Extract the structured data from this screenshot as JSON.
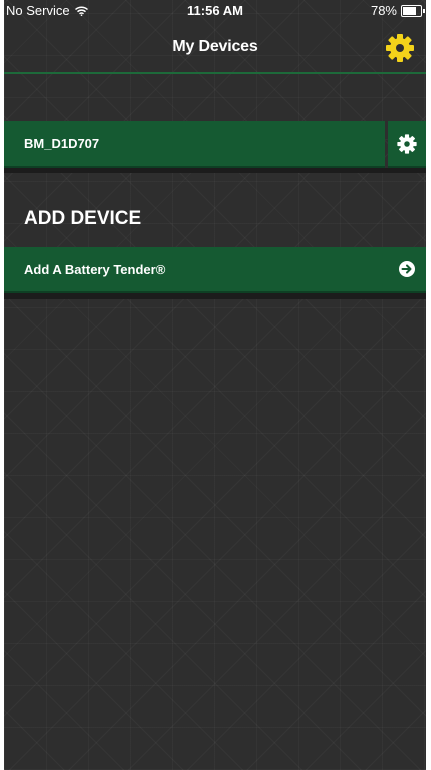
{
  "status_bar": {
    "carrier": "No Service",
    "time": "11:56 AM",
    "battery": "78%",
    "battery_level": 0.78
  },
  "nav": {
    "title": "My Devices",
    "settings_icon": "gear-icon",
    "settings_color": "#f3d31a"
  },
  "devices": [
    {
      "name": "BM_D1D707",
      "settings_icon": "gear-icon"
    }
  ],
  "add_section": {
    "title": "ADD DEVICE",
    "item_label": "Add A Battery Tender®",
    "item_icon": "arrow-circle-right-icon"
  },
  "colors": {
    "accent_green": "#155a32",
    "background": "#2e2e2e"
  }
}
